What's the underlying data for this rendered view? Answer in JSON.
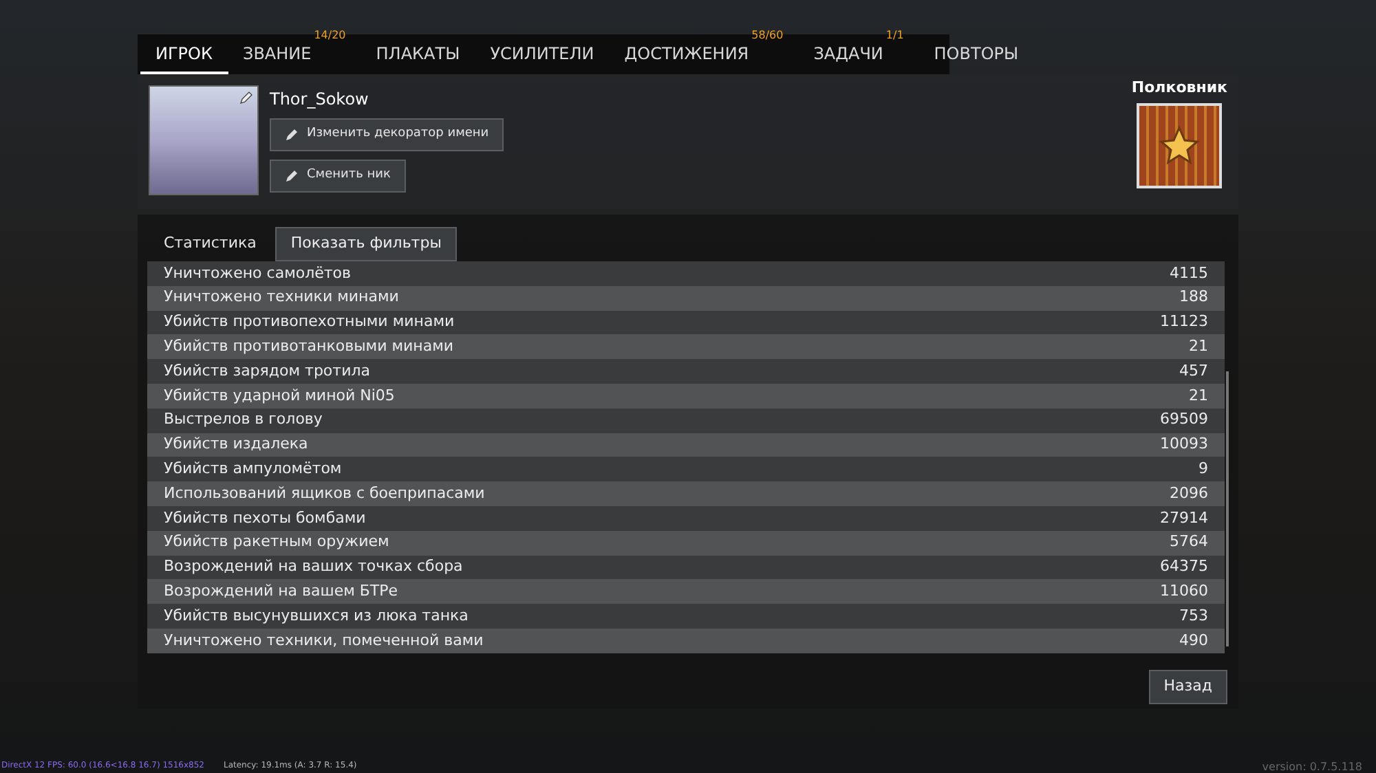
{
  "tabs": [
    {
      "label": "ИГРОК",
      "selected": true
    },
    {
      "label": "ЗВАНИЕ",
      "badge": "14/20",
      "selected": false
    },
    {
      "label": "ПЛАКАТЫ",
      "selected": false
    },
    {
      "label": "УСИЛИТЕЛИ",
      "selected": false
    },
    {
      "label": "ДОСТИЖЕНИЯ",
      "badge": "58/60",
      "selected": false
    },
    {
      "label": "ЗАДАЧИ",
      "badge": "1/1",
      "selected": false
    },
    {
      "label": "ПОВТОРЫ",
      "selected": false
    }
  ],
  "profile": {
    "nickname": "Thor_Sokow",
    "buttons": [
      "Изменить декоратор имени",
      "Сменить ник"
    ],
    "rank": "Полковник"
  },
  "stats": {
    "title": "Статистика",
    "filter_button": "Показать фильтры",
    "rows": [
      {
        "label": "Уничтожено самолётов",
        "value": "4115"
      },
      {
        "label": "Уничтожено техники минами",
        "value": "188"
      },
      {
        "label": "Убийств противопехотными минами",
        "value": "11123"
      },
      {
        "label": "Убийств противотанковыми минами",
        "value": "21"
      },
      {
        "label": "Убийств зарядом тротила",
        "value": "457"
      },
      {
        "label": "Убийств ударной миной Ni05",
        "value": "21"
      },
      {
        "label": "Выстрелов в голову",
        "value": "69509"
      },
      {
        "label": "Убийств издалека",
        "value": "10093"
      },
      {
        "label": "Убийств ампуломётом",
        "value": "9"
      },
      {
        "label": "Использований ящиков с боеприпасами",
        "value": "2096"
      },
      {
        "label": "Убийств пехоты бомбами",
        "value": "27914"
      },
      {
        "label": "Убийств ракетным оружием",
        "value": "5764"
      },
      {
        "label": "Возрождений на ваших точках сбора",
        "value": "64375"
      },
      {
        "label": "Возрождений на вашем БТРе",
        "value": "11060"
      },
      {
        "label": "Убийств высунувшихся из люка танка",
        "value": "753"
      },
      {
        "label": "Уничтожено техники, помеченной вами",
        "value": "490"
      }
    ]
  },
  "back_button": "Назад",
  "status_bar": {
    "fps": "DirectX 12 FPS: 60.0 (16.6<16.8 16.7) 1516x852",
    "latency": "Latency: 19.1ms (A: 3.7 R: 15.4)",
    "version": "version: 0.7.5.118"
  }
}
